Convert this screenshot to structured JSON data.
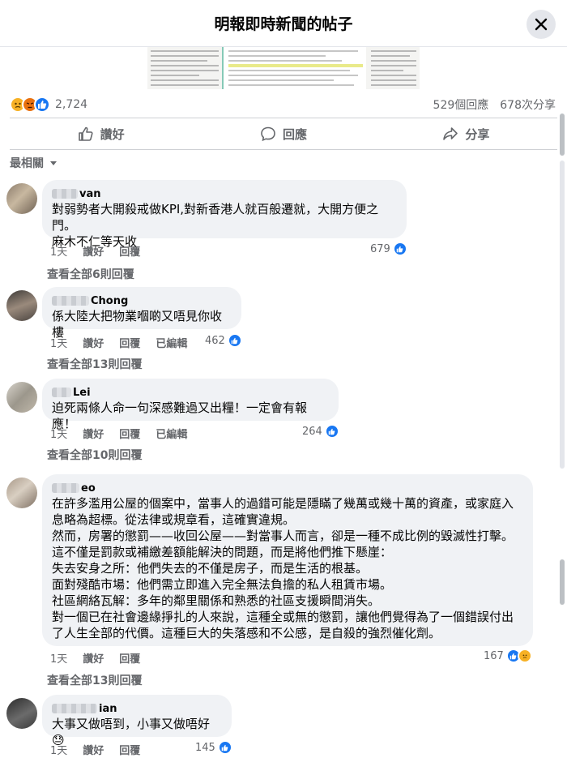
{
  "header": {
    "title": "明報即時新聞的帖子"
  },
  "post": {
    "reaction_count": "2,724",
    "comments_count": "529個回應",
    "shares_count": "678次分享",
    "actions": {
      "like": "讚好",
      "comment": "回應",
      "share": "分享"
    }
  },
  "sort": {
    "label": "最相關"
  },
  "comments": [
    {
      "name": "van",
      "text": "對弱勢者大開殺戒做KPI,對新香港人就百般遷就，大開方便之門。\n麻木不仁等天收",
      "time": "1天",
      "like": "讚好",
      "reply": "回覆",
      "edited": "",
      "likes": "679",
      "view_replies": "查看全部6則回覆"
    },
    {
      "name": "Chong",
      "text": "係大陸大把物業嗰啲又唔見你收樓",
      "time": "1天",
      "like": "讚好",
      "reply": "回覆",
      "edited": "已編輯",
      "likes": "462",
      "view_replies": "查看全部13則回覆"
    },
    {
      "name": "Lei",
      "text": "迫死兩條人命一句深感難過又出糧！一定會有報應！",
      "time": "1天",
      "like": "讚好",
      "reply": "回覆",
      "edited": "已編輯",
      "likes": "264",
      "view_replies": "查看全部10則回覆"
    },
    {
      "name": "eo",
      "text": "在許多濫用公屋的個案中，當事人的過錯可能是隱瞞了幾萬或幾十萬的資產，或家庭入息略為超標。從法律或規章看，這確實違規。\n然而，房署的懲罰——收回公屋——對當事人而言，卻是一種不成比例的毀滅性打擊。\n這不僅是罰款或補繳差額能解決的問題，而是將他們推下懸崖：\n失去安身之所：他們失去的不僅是房子，而是生活的根基。\n面對殘酷市場：他們需立即進入完全無法負擔的私人租賃市場。\n社區網絡瓦解：多年的鄰里關係和熟悉的社區支援瞬間消失。\n對一個已在社會邊緣掙扎的人來說，這種全或無的懲罰，讓他們覺得為了一個錯誤付出了人生全部的代價。這種巨大的失落感和不公感，是自殺的強烈催化劑。",
      "time": "1天",
      "like": "讚好",
      "reply": "回覆",
      "edited": "",
      "likes": "167",
      "view_replies": "查看全部13則回覆"
    },
    {
      "name": "ian",
      "text": "大事又做唔到，小事又做唔好😓",
      "time": "1天",
      "like": "讚好",
      "reply": "回覆",
      "edited": "",
      "likes": "145",
      "view_replies": ""
    }
  ],
  "colors": {
    "like_blue": "#1877f2",
    "meta_gray": "#65676b",
    "bubble_bg": "#f0f2f5"
  }
}
